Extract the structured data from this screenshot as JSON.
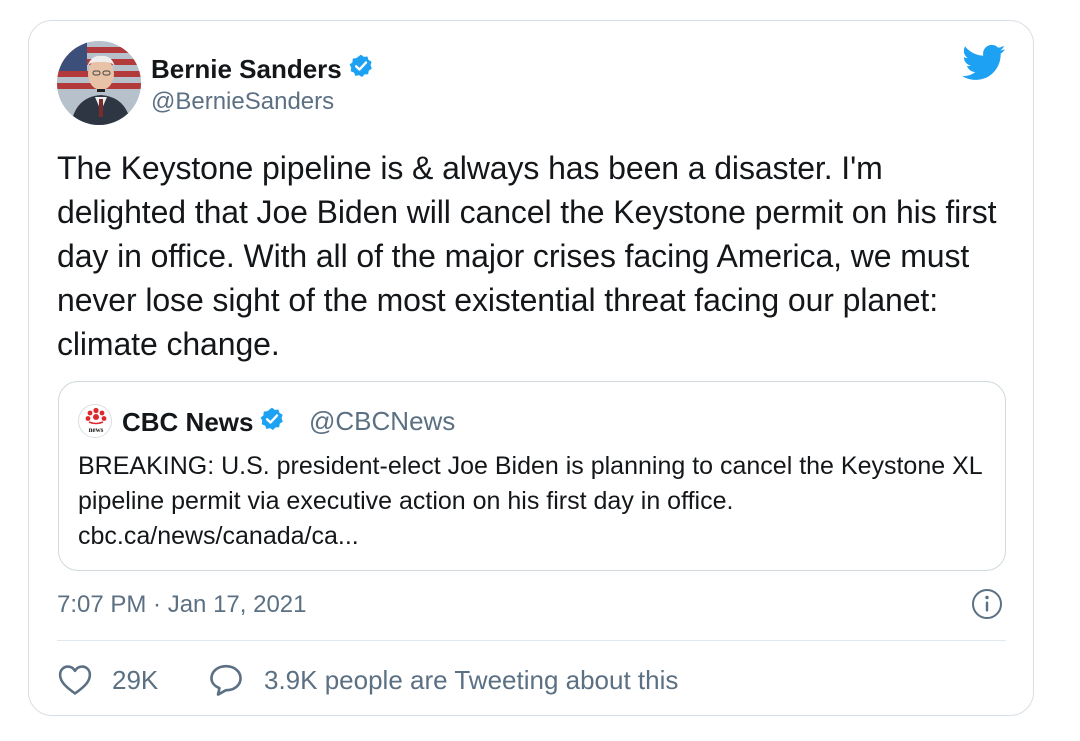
{
  "author": {
    "name": "Bernie Sanders",
    "handle": "@BernieSanders",
    "verified_icon": "verified-badge-icon"
  },
  "tweet": {
    "text": "The Keystone pipeline is & always has been a disaster. I'm delighted that Joe Biden will cancel the Keystone permit on his first day in office. With all of the major crises facing America, we must never lose sight of the most existential threat facing our planet: climate change.",
    "timestamp": "7:07 PM · Jan 17, 2021"
  },
  "quoted_tweet": {
    "name": "CBC News",
    "handle": "@CBCNews",
    "logo_text": "news",
    "text": "BREAKING: U.S. president-elect Joe Biden is planning to cancel the Keystone XL pipeline permit via executive action on his first day in office. cbc.ca/news/canada/ca..."
  },
  "actions": {
    "like_count": "29K",
    "tweeting_text": "3.9K people are Tweeting about this"
  },
  "colors": {
    "twitter_blue": "#1da1f2",
    "secondary_text": "#5b7083",
    "border": "#d8dfe5",
    "cbc_red": "#e0272e"
  }
}
